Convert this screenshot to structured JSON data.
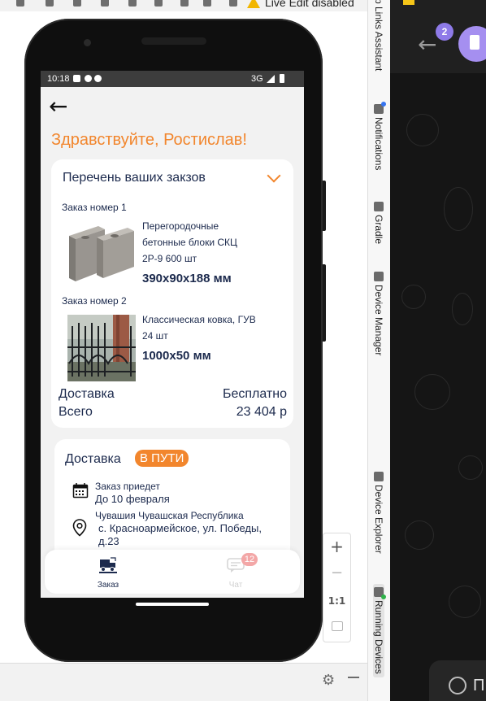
{
  "ide": {
    "top_warning": "Live Edit disabled",
    "tool_tabs": [
      {
        "label": "p Links Assistant"
      },
      {
        "label": "Notifications"
      },
      {
        "label": "Gradle"
      },
      {
        "label": "Device Manager"
      },
      {
        "label": "Device Explorer"
      },
      {
        "label": "Running Devices"
      }
    ],
    "zoom": {
      "plus": "+",
      "minus": "−",
      "actual": "1:1"
    }
  },
  "telegram": {
    "badge": "2",
    "partial_text": "П"
  },
  "phone": {
    "status": {
      "time": "10:18",
      "network": "3G"
    },
    "greeting": "Здравствуйте, Ростислав!",
    "orders": {
      "title": "Перечень ваших закзов",
      "items": [
        {
          "number": "Заказ номер 1",
          "name_line1": "Перегородочные",
          "name_line2": "бетонные блоки СКЦ",
          "name_line3": "2Р-9 600 шт",
          "size": "390x90x188 мм"
        },
        {
          "number": "Заказ номер 2",
          "name_line1": "Классическая ковка, ГУВ",
          "name_line2": "24 шт",
          "size": "1000x50 мм"
        }
      ],
      "delivery_label": "Доставка",
      "delivery_value": "Бесплатно",
      "total_label": "Всего",
      "total_value": "23 404 р"
    },
    "delivery": {
      "title": "Доставка",
      "status": "В ПУТИ",
      "arrival_label": "Заказ приедет",
      "arrival_value": "До 10 февраля",
      "address_line1": "Чувашия Чувашская Республика",
      "address_line2": "с. Красноармейское, ул. Победы,",
      "address_line3": "д.23"
    },
    "nav": [
      {
        "label": "Заказ",
        "color": "#1c2a4d"
      },
      {
        "label": "Чат",
        "color": "#cfcfcf",
        "badge": "12"
      }
    ],
    "accent": "#f2862d"
  }
}
